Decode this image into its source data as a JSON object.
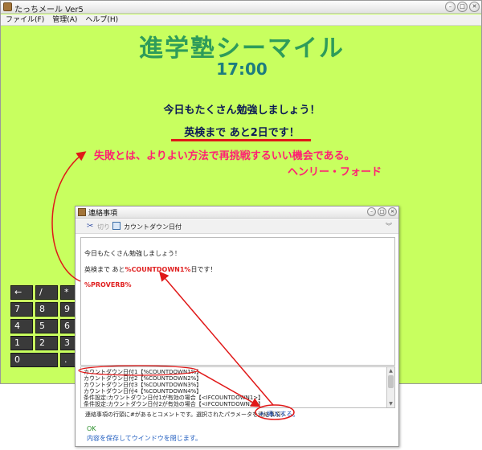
{
  "main_window": {
    "title": "たっちメール Ver5",
    "menu": [
      "ファイル(F)",
      "管理(A)",
      "ヘルプ(H)"
    ],
    "school_name": "進学塾シーマイル",
    "clock": "17:00",
    "line1": "今日もたくさん勉強しましょう！",
    "line2": "英検まで あと2日です！",
    "proverb": "失敗とは、よりよい方法で再挑戦するいい機会である。",
    "proverb_author": "ヘンリー・フォード",
    "keypad": [
      "←",
      "/",
      "*",
      "7",
      "8",
      "9",
      "4",
      "5",
      "6",
      "1",
      "2",
      "3",
      "0",
      "."
    ]
  },
  "dialog": {
    "title": "連絡事項",
    "toolbar": {
      "cut_label": "切り",
      "countdown_label": "カウントダウン日付"
    },
    "editor": {
      "line1": "今日もたくさん勉強しましょう！",
      "line2_prefix": "英検まで あと",
      "line2_token": "%COUNTDOWN1%",
      "line2_suffix": "日です！",
      "line3": "%PROVERB%"
    },
    "param_list": [
      "カウントダウン日付1【%COUNTDOWN1%】",
      "カウントダウン日付2【%COUNTDOWN2%】",
      "カウントダウン日付3【%COUNTDOWN3%】",
      "カウントダウン日付4【%COUNTDOWN4%】",
      "条件設定:カウントダウン日付1が有効の場合【<IFCOUNTDOWN1>】",
      "条件設定:カウントダウン日付2が有効の場合【<IFCOUNTDOWN2>】"
    ],
    "status_text": "連絡事項の行頭に#があるとコメントです。選択されたパラメータを連絡事項へ",
    "insert_label": "挿入する。",
    "ok_label": "OK",
    "close_hint": "内容を保存してウインドウを閉じます。"
  },
  "annotation_color": "#e01818"
}
